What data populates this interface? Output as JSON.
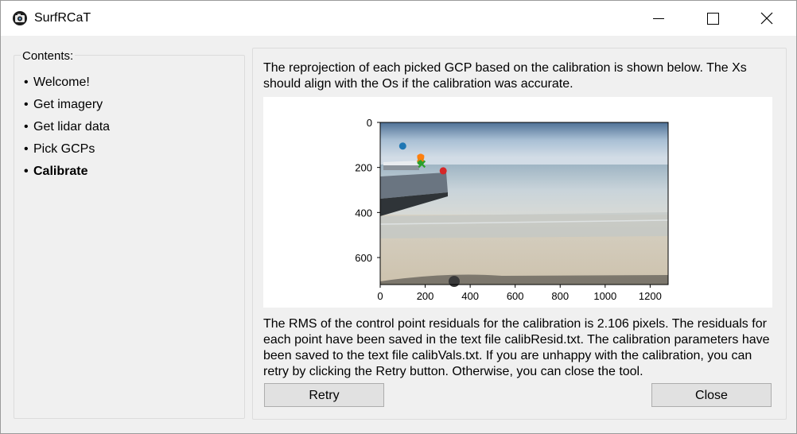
{
  "window": {
    "title": "SurfRCaT"
  },
  "sidebar": {
    "legend": "Contents:",
    "items": [
      {
        "label": "Welcome!",
        "active": false
      },
      {
        "label": "Get imagery",
        "active": false
      },
      {
        "label": "Get lidar data",
        "active": false
      },
      {
        "label": "Pick GCPs",
        "active": false
      },
      {
        "label": "Calibrate",
        "active": true
      }
    ]
  },
  "main": {
    "intro": "The reprojection of each picked GCP based on the calibration is shown below. The Xs should align with the Os if the calibration was accurate.",
    "result": "The RMS of the control point residuals for the calibration is 2.106 pixels. The residuals for each point have been saved in the text file calibResid.txt. The calibration parameters have been saved to the text file calibVals.txt. If you are unhappy with the calibration, you can retry by clicking the Retry button. Otherwise, you can close the tool.",
    "retry_label": "Retry",
    "close_label": "Close"
  },
  "chart_data": {
    "type": "scatter",
    "xlim": [
      0,
      1280
    ],
    "ylim": [
      720,
      0
    ],
    "xticks": [
      "0",
      "200",
      "400",
      "600",
      "800",
      "1000",
      "1200"
    ],
    "yticks": [
      "0",
      "200",
      "400",
      "600"
    ],
    "points": [
      {
        "x": 100,
        "y": 105,
        "marker": "o",
        "color": "#1f77b4"
      },
      {
        "x": 180,
        "y": 155,
        "marker": "o",
        "color": "#ff7f0e"
      },
      {
        "x": 180,
        "y": 175,
        "marker": "o",
        "color": "#2ca02c"
      },
      {
        "x": 280,
        "y": 215,
        "marker": "o",
        "color": "#d62728"
      },
      {
        "x": 180,
        "y": 160,
        "marker": "x",
        "color": "#ff7f0e"
      },
      {
        "x": 185,
        "y": 185,
        "marker": "x",
        "color": "#2ca02c"
      }
    ]
  }
}
